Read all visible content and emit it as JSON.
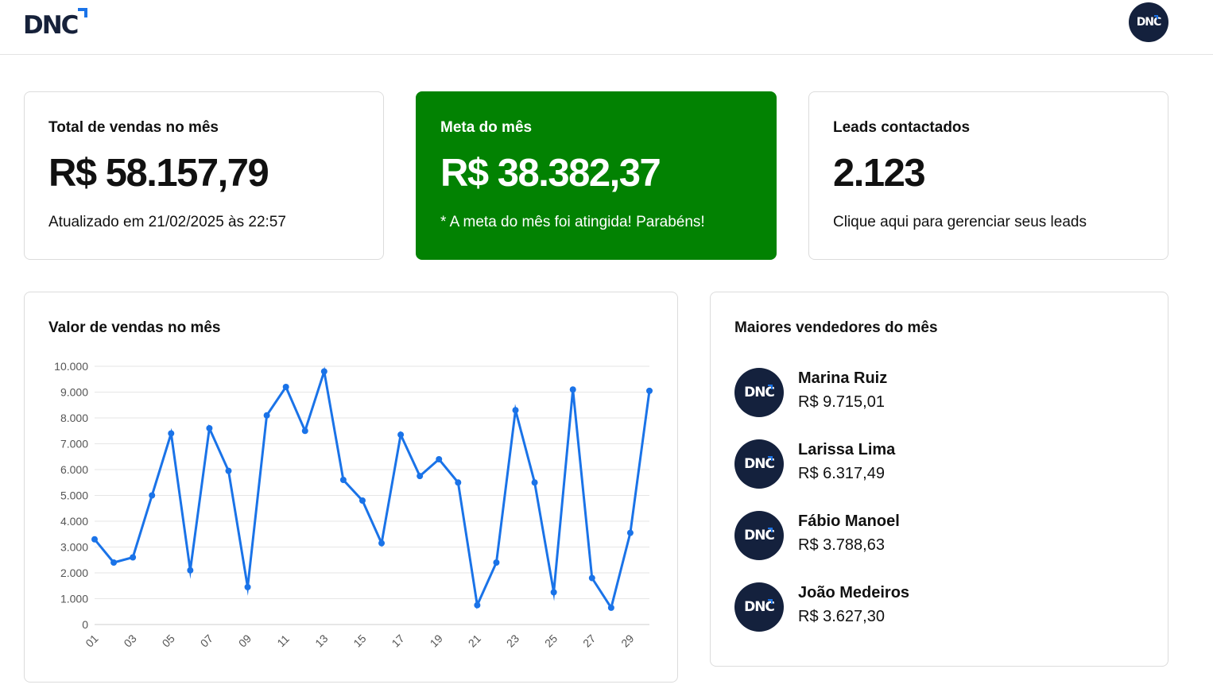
{
  "header": {
    "logo_text": "DNC",
    "avatar_text": "DNC"
  },
  "cards": {
    "total_sales": {
      "title": "Total de vendas no mês",
      "value": "R$ 58.157,79",
      "subtitle": "Atualizado em 21/02/2025 às 22:57"
    },
    "monthly_goal": {
      "title": "Meta do mês",
      "value": "R$ 38.382,37",
      "subtitle": "* A meta do mês foi atingida! Parabéns!",
      "color": "#028202"
    },
    "leads": {
      "title": "Leads contactados",
      "value": "2.123",
      "subtitle": "Clique aqui para gerenciar seus leads"
    }
  },
  "sales_chart": {
    "title": "Valor de vendas no mês"
  },
  "chart_data": {
    "type": "line",
    "x": [
      "01",
      "02",
      "03",
      "04",
      "05",
      "06",
      "07",
      "08",
      "09",
      "10",
      "11",
      "12",
      "13",
      "14",
      "15",
      "16",
      "17",
      "18",
      "19",
      "20",
      "21",
      "22",
      "23",
      "24",
      "25",
      "26",
      "27",
      "28",
      "29",
      "30"
    ],
    "x_tick_labels": [
      "01",
      "03",
      "05",
      "07",
      "09",
      "11",
      "13",
      "15",
      "17",
      "19",
      "21",
      "23",
      "25",
      "27",
      "29"
    ],
    "y_tick_labels": [
      "0",
      "1.000",
      "2.000",
      "3.000",
      "4.000",
      "5.000",
      "6.000",
      "7.000",
      "8.000",
      "9.000",
      "10.000"
    ],
    "series": [
      {
        "values": [
          3300,
          2400,
          2600,
          5000,
          7400,
          2100,
          7600,
          5950,
          1450,
          8100,
          9200,
          7500,
          9800,
          5600,
          4800,
          3150,
          7350,
          5750,
          6400,
          5500,
          750,
          2400,
          8300,
          5500,
          1250,
          9100,
          1800,
          650,
          3550,
          9050
        ],
        "color": "#1a73e8"
      }
    ],
    "ylim": [
      0,
      10000
    ],
    "grid": true,
    "legend": "none"
  },
  "top_sellers": {
    "title": "Maiores vendedores do mês",
    "sellers": [
      {
        "name": "Marina Ruiz",
        "amount": "R$ 9.715,01",
        "avatar_text": "DNC"
      },
      {
        "name": "Larissa Lima",
        "amount": "R$ 6.317,49",
        "avatar_text": "DNC"
      },
      {
        "name": "Fábio Manoel",
        "amount": "R$ 3.788,63",
        "avatar_text": "DNC"
      },
      {
        "name": "João Medeiros",
        "amount": "R$ 3.627,30",
        "avatar_text": "DNC"
      }
    ]
  },
  "colors": {
    "brand_navy": "#14213d",
    "brand_blue": "#1a73e8",
    "success_green": "#028202"
  }
}
